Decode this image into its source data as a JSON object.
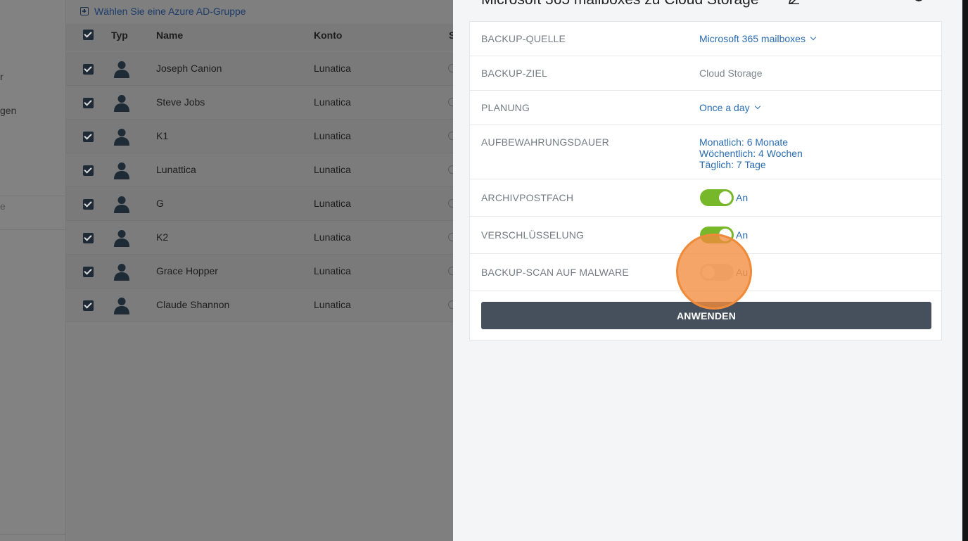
{
  "sidebar": {
    "fragments": [
      "r",
      "gen",
      "e"
    ]
  },
  "main": {
    "add_group_label": "Wählen Sie eine Azure AD-Gruppe",
    "columns": [
      "Typ",
      "Name",
      "Konto",
      "S"
    ],
    "rows": [
      {
        "name": "Joseph Canion",
        "account": "Lunatica"
      },
      {
        "name": "Steve Jobs",
        "account": "Lunatica"
      },
      {
        "name": "K1",
        "account": "Lunatica"
      },
      {
        "name": "Lunattica",
        "account": "Lunatica"
      },
      {
        "name": "G",
        "account": "Lunatica"
      },
      {
        "name": "K2",
        "account": "Lunatica"
      },
      {
        "name": "Grace Hopper",
        "account": "Lunatica"
      },
      {
        "name": "Claude Shannon",
        "account": "Lunatica"
      }
    ]
  },
  "panel": {
    "title": "Microsoft 365 mailboxes zu Cloud Storage",
    "rows": {
      "source": {
        "label": "BACKUP-QUELLE",
        "value": "Microsoft 365 mailboxes"
      },
      "target": {
        "label": "BACKUP-ZIEL",
        "value": "Cloud Storage"
      },
      "schedule": {
        "label": "PLANUNG",
        "value": "Once a day"
      },
      "retention": {
        "label": "AUFBEWAHRUNGSDAUER",
        "lines": [
          "Monatlich: 6 Monate",
          "Wöchentlich: 4 Wochen",
          "Täglich: 7 Tage"
        ]
      },
      "archive": {
        "label": "ARCHIVPOSTFACH",
        "state": "An"
      },
      "encryption": {
        "label": "VERSCHLÜSSELUNG",
        "state": "An"
      },
      "malware": {
        "label": "BACKUP-SCAN AUF MALWARE",
        "state": "Au"
      }
    },
    "apply_label": "ANWENDEN"
  }
}
